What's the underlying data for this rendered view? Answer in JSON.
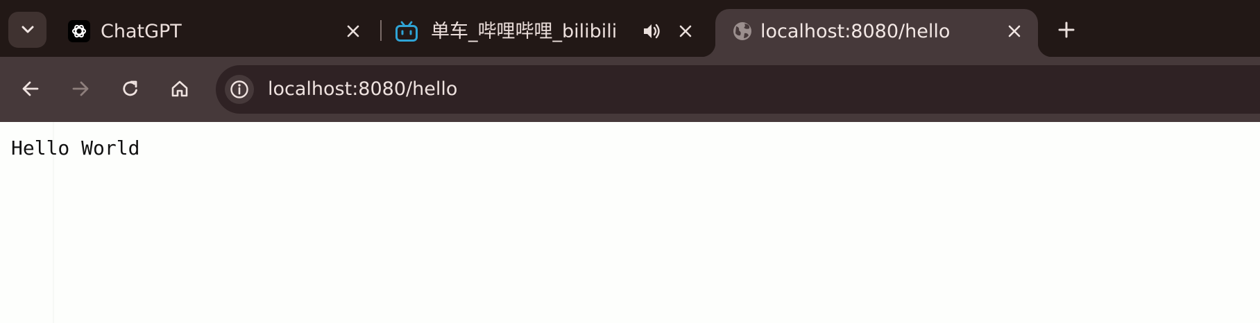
{
  "browser": {
    "tabs": [
      {
        "title": "ChatGPT",
        "icon": "chatgpt-logo-icon"
      },
      {
        "title": "单车_哔哩哔哩_bilibili",
        "icon": "bilibili-logo-icon",
        "audio_icon": "speaker-icon"
      },
      {
        "title": "localhost:8080/hello",
        "icon": "globe-icon",
        "active": true
      }
    ],
    "toolbar": {
      "back_icon": "back-arrow-icon",
      "forward_icon": "forward-arrow-icon",
      "reload_icon": "reload-icon",
      "home_icon": "home-icon",
      "site_info_icon": "info-icon",
      "url": "localhost:8080/hello"
    },
    "colors": {
      "frame": "#221816",
      "toolbar": "#46393a",
      "omnibox": "#2f2224",
      "bilibili_blue": "#2fa4d6"
    }
  },
  "page": {
    "text": "Hello World"
  }
}
